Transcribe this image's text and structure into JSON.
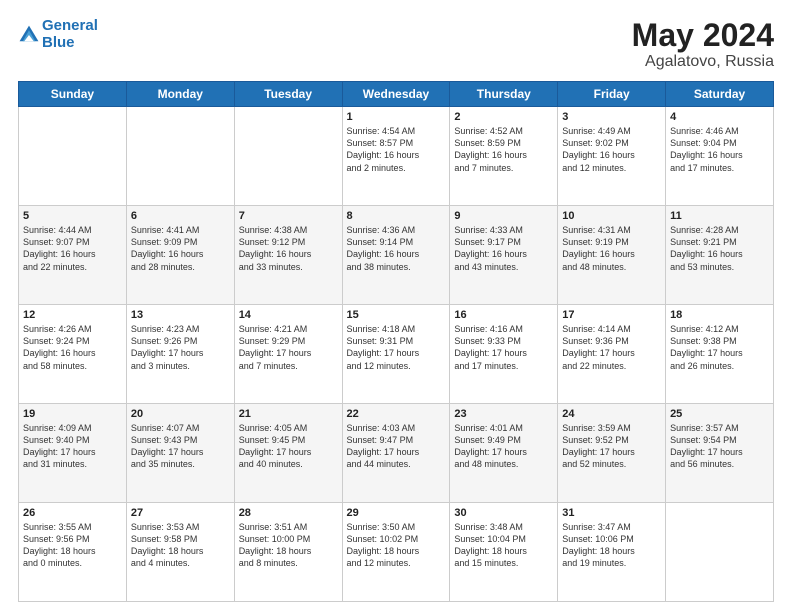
{
  "header": {
    "logo_line1": "General",
    "logo_line2": "Blue",
    "month_year": "May 2024",
    "location": "Agalatovo, Russia"
  },
  "days_of_week": [
    "Sunday",
    "Monday",
    "Tuesday",
    "Wednesday",
    "Thursday",
    "Friday",
    "Saturday"
  ],
  "weeks": [
    [
      {
        "num": "",
        "info": ""
      },
      {
        "num": "",
        "info": ""
      },
      {
        "num": "",
        "info": ""
      },
      {
        "num": "1",
        "info": "Sunrise: 4:54 AM\nSunset: 8:57 PM\nDaylight: 16 hours\nand 2 minutes."
      },
      {
        "num": "2",
        "info": "Sunrise: 4:52 AM\nSunset: 8:59 PM\nDaylight: 16 hours\nand 7 minutes."
      },
      {
        "num": "3",
        "info": "Sunrise: 4:49 AM\nSunset: 9:02 PM\nDaylight: 16 hours\nand 12 minutes."
      },
      {
        "num": "4",
        "info": "Sunrise: 4:46 AM\nSunset: 9:04 PM\nDaylight: 16 hours\nand 17 minutes."
      }
    ],
    [
      {
        "num": "5",
        "info": "Sunrise: 4:44 AM\nSunset: 9:07 PM\nDaylight: 16 hours\nand 22 minutes."
      },
      {
        "num": "6",
        "info": "Sunrise: 4:41 AM\nSunset: 9:09 PM\nDaylight: 16 hours\nand 28 minutes."
      },
      {
        "num": "7",
        "info": "Sunrise: 4:38 AM\nSunset: 9:12 PM\nDaylight: 16 hours\nand 33 minutes."
      },
      {
        "num": "8",
        "info": "Sunrise: 4:36 AM\nSunset: 9:14 PM\nDaylight: 16 hours\nand 38 minutes."
      },
      {
        "num": "9",
        "info": "Sunrise: 4:33 AM\nSunset: 9:17 PM\nDaylight: 16 hours\nand 43 minutes."
      },
      {
        "num": "10",
        "info": "Sunrise: 4:31 AM\nSunset: 9:19 PM\nDaylight: 16 hours\nand 48 minutes."
      },
      {
        "num": "11",
        "info": "Sunrise: 4:28 AM\nSunset: 9:21 PM\nDaylight: 16 hours\nand 53 minutes."
      }
    ],
    [
      {
        "num": "12",
        "info": "Sunrise: 4:26 AM\nSunset: 9:24 PM\nDaylight: 16 hours\nand 58 minutes."
      },
      {
        "num": "13",
        "info": "Sunrise: 4:23 AM\nSunset: 9:26 PM\nDaylight: 17 hours\nand 3 minutes."
      },
      {
        "num": "14",
        "info": "Sunrise: 4:21 AM\nSunset: 9:29 PM\nDaylight: 17 hours\nand 7 minutes."
      },
      {
        "num": "15",
        "info": "Sunrise: 4:18 AM\nSunset: 9:31 PM\nDaylight: 17 hours\nand 12 minutes."
      },
      {
        "num": "16",
        "info": "Sunrise: 4:16 AM\nSunset: 9:33 PM\nDaylight: 17 hours\nand 17 minutes."
      },
      {
        "num": "17",
        "info": "Sunrise: 4:14 AM\nSunset: 9:36 PM\nDaylight: 17 hours\nand 22 minutes."
      },
      {
        "num": "18",
        "info": "Sunrise: 4:12 AM\nSunset: 9:38 PM\nDaylight: 17 hours\nand 26 minutes."
      }
    ],
    [
      {
        "num": "19",
        "info": "Sunrise: 4:09 AM\nSunset: 9:40 PM\nDaylight: 17 hours\nand 31 minutes."
      },
      {
        "num": "20",
        "info": "Sunrise: 4:07 AM\nSunset: 9:43 PM\nDaylight: 17 hours\nand 35 minutes."
      },
      {
        "num": "21",
        "info": "Sunrise: 4:05 AM\nSunset: 9:45 PM\nDaylight: 17 hours\nand 40 minutes."
      },
      {
        "num": "22",
        "info": "Sunrise: 4:03 AM\nSunset: 9:47 PM\nDaylight: 17 hours\nand 44 minutes."
      },
      {
        "num": "23",
        "info": "Sunrise: 4:01 AM\nSunset: 9:49 PM\nDaylight: 17 hours\nand 48 minutes."
      },
      {
        "num": "24",
        "info": "Sunrise: 3:59 AM\nSunset: 9:52 PM\nDaylight: 17 hours\nand 52 minutes."
      },
      {
        "num": "25",
        "info": "Sunrise: 3:57 AM\nSunset: 9:54 PM\nDaylight: 17 hours\nand 56 minutes."
      }
    ],
    [
      {
        "num": "26",
        "info": "Sunrise: 3:55 AM\nSunset: 9:56 PM\nDaylight: 18 hours\nand 0 minutes."
      },
      {
        "num": "27",
        "info": "Sunrise: 3:53 AM\nSunset: 9:58 PM\nDaylight: 18 hours\nand 4 minutes."
      },
      {
        "num": "28",
        "info": "Sunrise: 3:51 AM\nSunset: 10:00 PM\nDaylight: 18 hours\nand 8 minutes."
      },
      {
        "num": "29",
        "info": "Sunrise: 3:50 AM\nSunset: 10:02 PM\nDaylight: 18 hours\nand 12 minutes."
      },
      {
        "num": "30",
        "info": "Sunrise: 3:48 AM\nSunset: 10:04 PM\nDaylight: 18 hours\nand 15 minutes."
      },
      {
        "num": "31",
        "info": "Sunrise: 3:47 AM\nSunset: 10:06 PM\nDaylight: 18 hours\nand 19 minutes."
      },
      {
        "num": "",
        "info": ""
      }
    ]
  ]
}
